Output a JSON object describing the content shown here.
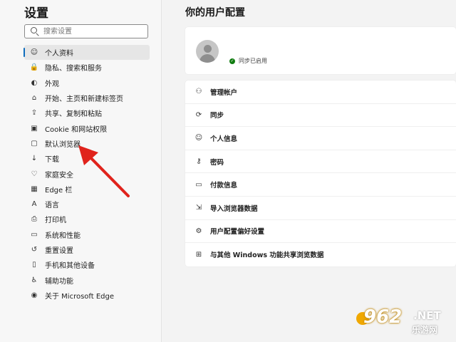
{
  "sidebar": {
    "title": "设置",
    "search_placeholder": "搜索设置",
    "items": [
      {
        "label": "个人资料",
        "icon": "profile-icon",
        "glyph": "☺",
        "active": true
      },
      {
        "label": "隐私、搜索和服务",
        "icon": "lock-icon",
        "glyph": "🔒",
        "active": false
      },
      {
        "label": "外观",
        "icon": "appearance-icon",
        "glyph": "◐",
        "active": false
      },
      {
        "label": "开始、主页和新建标签页",
        "icon": "home-tab-icon",
        "glyph": "⌂",
        "active": false
      },
      {
        "label": "共享、复制和粘贴",
        "icon": "share-icon",
        "glyph": "⇪",
        "active": false
      },
      {
        "label": "Cookie 和网站权限",
        "icon": "cookie-icon",
        "glyph": "▣",
        "active": false
      },
      {
        "label": "默认浏览器",
        "icon": "default-browser-icon",
        "glyph": "▢",
        "active": false
      },
      {
        "label": "下载",
        "icon": "download-icon",
        "glyph": "↓",
        "active": false
      },
      {
        "label": "家庭安全",
        "icon": "family-icon",
        "glyph": "♡",
        "active": false
      },
      {
        "label": "Edge 栏",
        "icon": "edge-bar-icon",
        "glyph": "▦",
        "active": false
      },
      {
        "label": "语言",
        "icon": "language-icon",
        "glyph": "A",
        "active": false
      },
      {
        "label": "打印机",
        "icon": "printer-icon",
        "glyph": "⎙",
        "active": false
      },
      {
        "label": "系统和性能",
        "icon": "system-icon",
        "glyph": "▭",
        "active": false
      },
      {
        "label": "重置设置",
        "icon": "reset-icon",
        "glyph": "↺",
        "active": false
      },
      {
        "label": "手机和其他设备",
        "icon": "phone-icon",
        "glyph": "▯",
        "active": false
      },
      {
        "label": "辅助功能",
        "icon": "accessibility-icon",
        "glyph": "♿",
        "active": false
      },
      {
        "label": "关于 Microsoft Edge",
        "icon": "edge-logo-icon",
        "glyph": "◉",
        "active": false
      }
    ]
  },
  "main": {
    "title": "你的用户配置",
    "profile": {
      "sync_status": "同步已启用",
      "sync_color": "#107c10"
    },
    "menu": [
      {
        "label": "管理帐户",
        "icon": "manage-account-icon",
        "glyph": "⚇"
      },
      {
        "label": "同步",
        "icon": "sync-icon",
        "glyph": "⟳"
      },
      {
        "label": "个人信息",
        "icon": "personal-info-icon",
        "glyph": "☺"
      },
      {
        "label": "密码",
        "icon": "key-icon",
        "glyph": "⚷"
      },
      {
        "label": "付款信息",
        "icon": "card-icon",
        "glyph": "▭"
      },
      {
        "label": "导入浏览器数据",
        "icon": "import-icon",
        "glyph": "⇲"
      },
      {
        "label": "用户配置偏好设置",
        "icon": "profile-prefs-icon",
        "glyph": "⚙"
      },
      {
        "label": "与其他 Windows 功能共享浏览数据",
        "icon": "windows-icon",
        "glyph": "⊞"
      }
    ]
  },
  "watermark": {
    "number": "962",
    "suffix": ".NET",
    "sub": "乐游网"
  },
  "colors": {
    "accent": "#0f6cbd",
    "arrow": "#e0231c",
    "sidebar_bg": "#f7f7f7",
    "page_bg": "#f3f3f3"
  }
}
